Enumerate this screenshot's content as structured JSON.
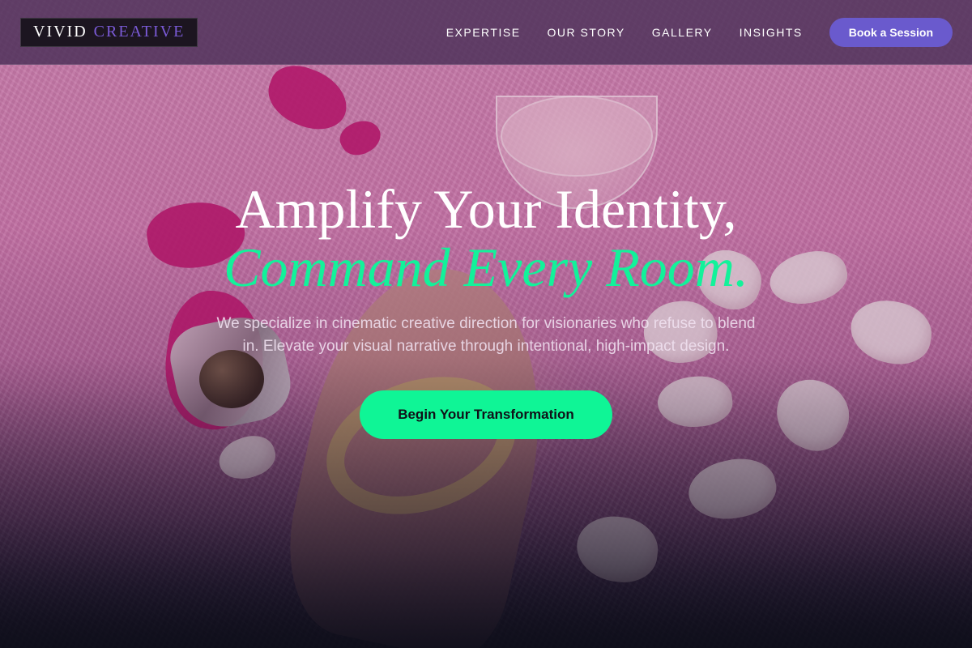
{
  "brand": {
    "name_primary": "VIVID",
    "name_secondary": "CREATIVE"
  },
  "nav": {
    "links": [
      "EXPERTISE",
      "OUR STORY",
      "GALLERY",
      "INSIGHTS"
    ],
    "cta_label": "Book a Session"
  },
  "hero": {
    "headline_line1": "Amplify Your Identity,",
    "headline_line2": "Command Every Room.",
    "subtitle": "We specialize in cinematic creative direction for visionaries who refuse to blend in. Elevate your visual narrative through intentional, high-impact design.",
    "cta_label": "Begin Your Transformation"
  },
  "colors": {
    "accent_green": "#12f29a",
    "accent_purple": "#6a5acd",
    "background_pink": "#d97fb3"
  }
}
